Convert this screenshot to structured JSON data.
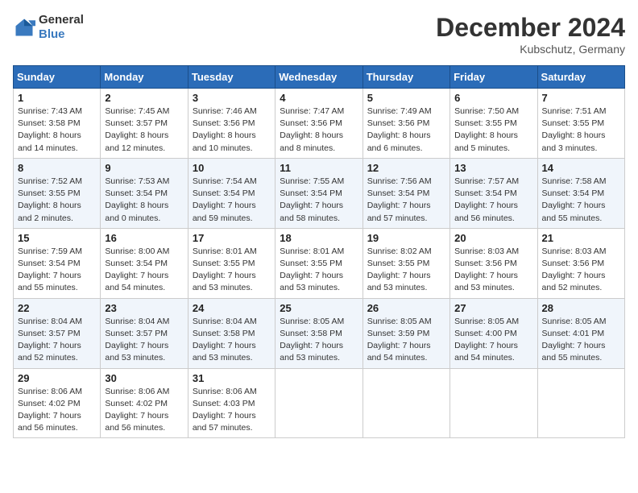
{
  "header": {
    "logo_general": "General",
    "logo_blue": "Blue",
    "title": "December 2024",
    "location": "Kubschutz, Germany"
  },
  "days_of_week": [
    "Sunday",
    "Monday",
    "Tuesday",
    "Wednesday",
    "Thursday",
    "Friday",
    "Saturday"
  ],
  "weeks": [
    [
      {
        "day": "1",
        "lines": [
          "Sunrise: 7:43 AM",
          "Sunset: 3:58 PM",
          "Daylight: 8 hours",
          "and 14 minutes."
        ]
      },
      {
        "day": "2",
        "lines": [
          "Sunrise: 7:45 AM",
          "Sunset: 3:57 PM",
          "Daylight: 8 hours",
          "and 12 minutes."
        ]
      },
      {
        "day": "3",
        "lines": [
          "Sunrise: 7:46 AM",
          "Sunset: 3:56 PM",
          "Daylight: 8 hours",
          "and 10 minutes."
        ]
      },
      {
        "day": "4",
        "lines": [
          "Sunrise: 7:47 AM",
          "Sunset: 3:56 PM",
          "Daylight: 8 hours",
          "and 8 minutes."
        ]
      },
      {
        "day": "5",
        "lines": [
          "Sunrise: 7:49 AM",
          "Sunset: 3:56 PM",
          "Daylight: 8 hours",
          "and 6 minutes."
        ]
      },
      {
        "day": "6",
        "lines": [
          "Sunrise: 7:50 AM",
          "Sunset: 3:55 PM",
          "Daylight: 8 hours",
          "and 5 minutes."
        ]
      },
      {
        "day": "7",
        "lines": [
          "Sunrise: 7:51 AM",
          "Sunset: 3:55 PM",
          "Daylight: 8 hours",
          "and 3 minutes."
        ]
      }
    ],
    [
      {
        "day": "8",
        "lines": [
          "Sunrise: 7:52 AM",
          "Sunset: 3:55 PM",
          "Daylight: 8 hours",
          "and 2 minutes."
        ]
      },
      {
        "day": "9",
        "lines": [
          "Sunrise: 7:53 AM",
          "Sunset: 3:54 PM",
          "Daylight: 8 hours",
          "and 0 minutes."
        ]
      },
      {
        "day": "10",
        "lines": [
          "Sunrise: 7:54 AM",
          "Sunset: 3:54 PM",
          "Daylight: 7 hours",
          "and 59 minutes."
        ]
      },
      {
        "day": "11",
        "lines": [
          "Sunrise: 7:55 AM",
          "Sunset: 3:54 PM",
          "Daylight: 7 hours",
          "and 58 minutes."
        ]
      },
      {
        "day": "12",
        "lines": [
          "Sunrise: 7:56 AM",
          "Sunset: 3:54 PM",
          "Daylight: 7 hours",
          "and 57 minutes."
        ]
      },
      {
        "day": "13",
        "lines": [
          "Sunrise: 7:57 AM",
          "Sunset: 3:54 PM",
          "Daylight: 7 hours",
          "and 56 minutes."
        ]
      },
      {
        "day": "14",
        "lines": [
          "Sunrise: 7:58 AM",
          "Sunset: 3:54 PM",
          "Daylight: 7 hours",
          "and 55 minutes."
        ]
      }
    ],
    [
      {
        "day": "15",
        "lines": [
          "Sunrise: 7:59 AM",
          "Sunset: 3:54 PM",
          "Daylight: 7 hours",
          "and 55 minutes."
        ]
      },
      {
        "day": "16",
        "lines": [
          "Sunrise: 8:00 AM",
          "Sunset: 3:54 PM",
          "Daylight: 7 hours",
          "and 54 minutes."
        ]
      },
      {
        "day": "17",
        "lines": [
          "Sunrise: 8:01 AM",
          "Sunset: 3:55 PM",
          "Daylight: 7 hours",
          "and 53 minutes."
        ]
      },
      {
        "day": "18",
        "lines": [
          "Sunrise: 8:01 AM",
          "Sunset: 3:55 PM",
          "Daylight: 7 hours",
          "and 53 minutes."
        ]
      },
      {
        "day": "19",
        "lines": [
          "Sunrise: 8:02 AM",
          "Sunset: 3:55 PM",
          "Daylight: 7 hours",
          "and 53 minutes."
        ]
      },
      {
        "day": "20",
        "lines": [
          "Sunrise: 8:03 AM",
          "Sunset: 3:56 PM",
          "Daylight: 7 hours",
          "and 53 minutes."
        ]
      },
      {
        "day": "21",
        "lines": [
          "Sunrise: 8:03 AM",
          "Sunset: 3:56 PM",
          "Daylight: 7 hours",
          "and 52 minutes."
        ]
      }
    ],
    [
      {
        "day": "22",
        "lines": [
          "Sunrise: 8:04 AM",
          "Sunset: 3:57 PM",
          "Daylight: 7 hours",
          "and 52 minutes."
        ]
      },
      {
        "day": "23",
        "lines": [
          "Sunrise: 8:04 AM",
          "Sunset: 3:57 PM",
          "Daylight: 7 hours",
          "and 53 minutes."
        ]
      },
      {
        "day": "24",
        "lines": [
          "Sunrise: 8:04 AM",
          "Sunset: 3:58 PM",
          "Daylight: 7 hours",
          "and 53 minutes."
        ]
      },
      {
        "day": "25",
        "lines": [
          "Sunrise: 8:05 AM",
          "Sunset: 3:58 PM",
          "Daylight: 7 hours",
          "and 53 minutes."
        ]
      },
      {
        "day": "26",
        "lines": [
          "Sunrise: 8:05 AM",
          "Sunset: 3:59 PM",
          "Daylight: 7 hours",
          "and 54 minutes."
        ]
      },
      {
        "day": "27",
        "lines": [
          "Sunrise: 8:05 AM",
          "Sunset: 4:00 PM",
          "Daylight: 7 hours",
          "and 54 minutes."
        ]
      },
      {
        "day": "28",
        "lines": [
          "Sunrise: 8:05 AM",
          "Sunset: 4:01 PM",
          "Daylight: 7 hours",
          "and 55 minutes."
        ]
      }
    ],
    [
      {
        "day": "29",
        "lines": [
          "Sunrise: 8:06 AM",
          "Sunset: 4:02 PM",
          "Daylight: 7 hours",
          "and 56 minutes."
        ]
      },
      {
        "day": "30",
        "lines": [
          "Sunrise: 8:06 AM",
          "Sunset: 4:02 PM",
          "Daylight: 7 hours",
          "and 56 minutes."
        ]
      },
      {
        "day": "31",
        "lines": [
          "Sunrise: 8:06 AM",
          "Sunset: 4:03 PM",
          "Daylight: 7 hours",
          "and 57 minutes."
        ]
      },
      null,
      null,
      null,
      null
    ]
  ]
}
